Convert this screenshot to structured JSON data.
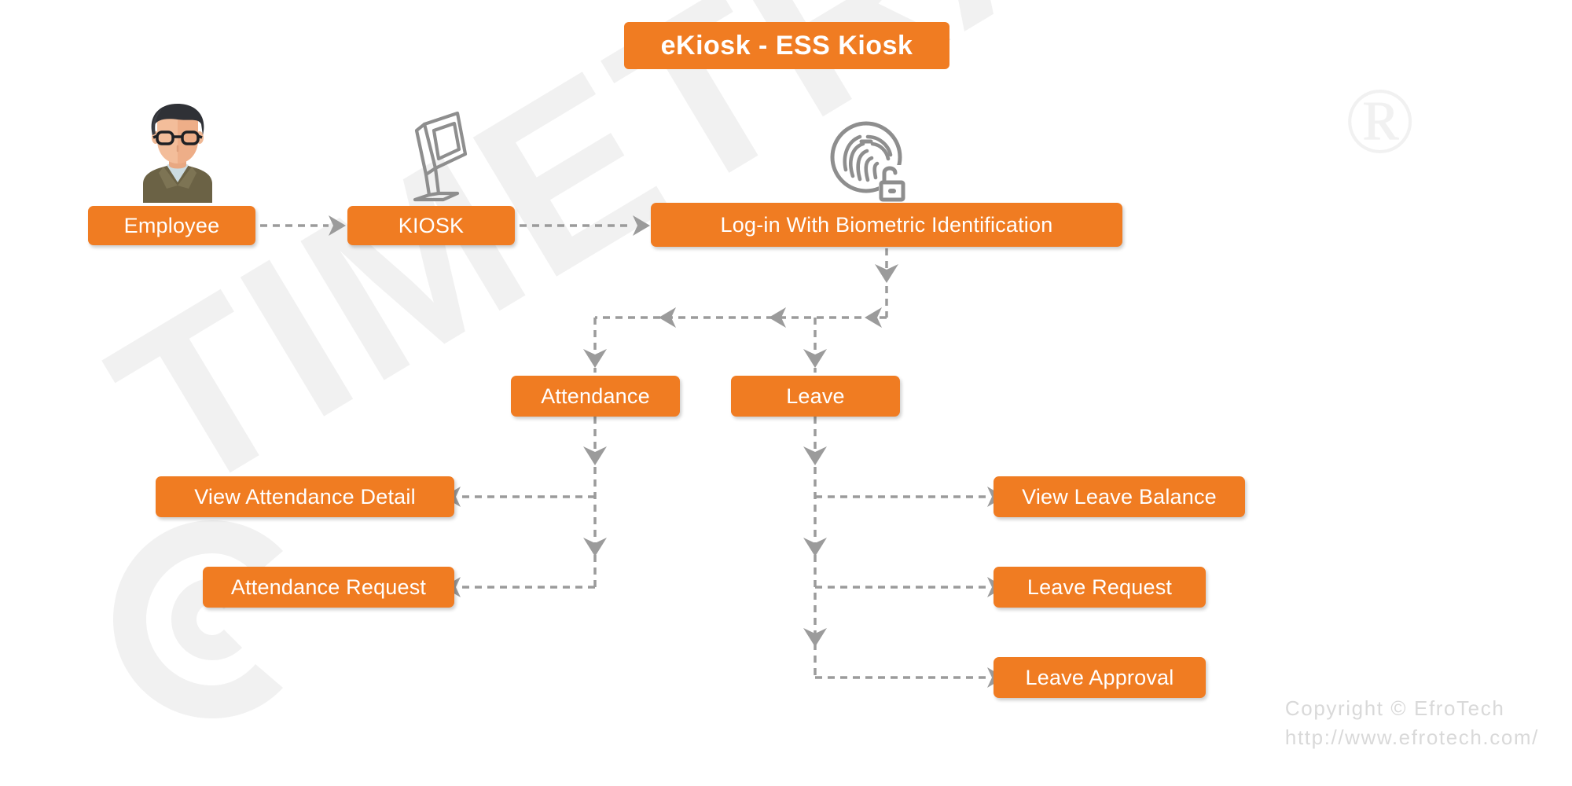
{
  "title": {
    "text": "eKiosk - ESS Kiosk"
  },
  "colors": {
    "node_fill": "#f07c22",
    "node_text": "#ffffff",
    "connector": "#9b9b9b",
    "background": "#ffffff",
    "watermark": "#f1f1f1",
    "footer_text": "#d9d9d9"
  },
  "nodes": {
    "employee": "Employee",
    "kiosk": "KIOSK",
    "biometric": "Log-in With Biometric Identification",
    "attendance": "Attendance",
    "leave": "Leave",
    "view_attendance_detail": "View Attendance Detail",
    "attendance_request": "Attendance Request",
    "view_leave_balance": "View Leave Balance",
    "leave_request": "Leave Request",
    "leave_approval": "Leave Approval"
  },
  "icons": {
    "employee": "employee-avatar-icon",
    "kiosk": "kiosk-terminal-icon",
    "biometric": "fingerprint-lock-icon"
  },
  "watermark": {
    "text": "TIMETRAX",
    "registered_mark": "®"
  },
  "footer": {
    "copyright": "Copyright © EfroTech",
    "url": "http://www.efrotech.com/"
  },
  "flow": {
    "edges": [
      {
        "from": "employee",
        "to": "kiosk",
        "style": "dashed-arrow"
      },
      {
        "from": "kiosk",
        "to": "biometric",
        "style": "dashed-arrow"
      },
      {
        "from": "biometric",
        "to": "attendance",
        "style": "dashed-arrow"
      },
      {
        "from": "biometric",
        "to": "leave",
        "style": "dashed-arrow"
      },
      {
        "from": "attendance",
        "to": "view_attendance_detail",
        "style": "dashed-arrow"
      },
      {
        "from": "attendance",
        "to": "attendance_request",
        "style": "dashed-arrow"
      },
      {
        "from": "leave",
        "to": "view_leave_balance",
        "style": "dashed-arrow"
      },
      {
        "from": "leave",
        "to": "leave_request",
        "style": "dashed-arrow"
      },
      {
        "from": "leave",
        "to": "leave_approval",
        "style": "dashed-arrow"
      }
    ]
  }
}
